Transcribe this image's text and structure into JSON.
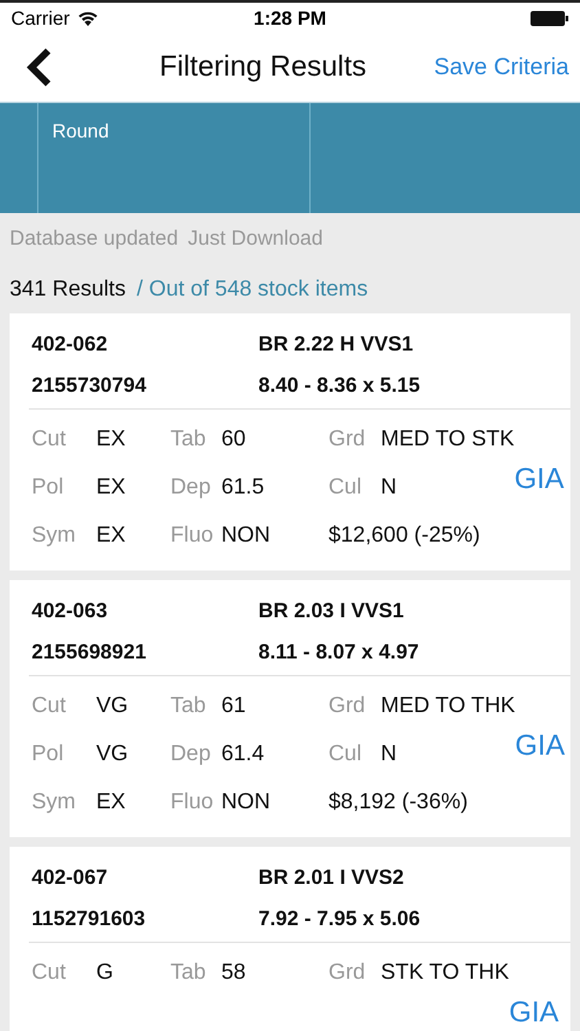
{
  "status_bar": {
    "carrier": "Carrier",
    "time": "1:28 PM"
  },
  "nav": {
    "title": "Filtering Results",
    "action": "Save Criteria"
  },
  "filter_bar": {
    "shape": "Round"
  },
  "info": {
    "status": "Database updated",
    "download": "Just Download"
  },
  "results": {
    "count": "341 Results",
    "total": "/ Out of 548 stock items"
  },
  "items": [
    {
      "stock_no": "402-062",
      "description": "BR 2.22 H VVS1",
      "id": "2155730794",
      "measurements": "8.40 - 8.36 x 5.15",
      "details": [
        {
          "label": "Cut",
          "value": "EX"
        },
        {
          "label": "Tab",
          "value": "60"
        },
        {
          "label": "Grd",
          "value": "MED TO STK"
        },
        {
          "label": "Pol",
          "value": "EX"
        },
        {
          "label": "Dep",
          "value": "61.5"
        },
        {
          "label": "Cul",
          "value": "N"
        },
        {
          "label": "Sym",
          "value": "EX"
        },
        {
          "label": "Fluo",
          "value": "NON"
        }
      ],
      "price": "$12,600 (-25%)",
      "lab": "GIA"
    },
    {
      "stock_no": "402-063",
      "description": "BR 2.03 I VVS1",
      "id": "2155698921",
      "measurements": "8.11 - 8.07 x 4.97",
      "details": [
        {
          "label": "Cut",
          "value": "VG"
        },
        {
          "label": "Tab",
          "value": "61"
        },
        {
          "label": "Grd",
          "value": "MED TO THK"
        },
        {
          "label": "Pol",
          "value": "VG"
        },
        {
          "label": "Dep",
          "value": "61.4"
        },
        {
          "label": "Cul",
          "value": "N"
        },
        {
          "label": "Sym",
          "value": "EX"
        },
        {
          "label": "Fluo",
          "value": "NON"
        }
      ],
      "price": "$8,192 (-36%)",
      "lab": "GIA"
    },
    {
      "stock_no": "402-067",
      "description": "BR 2.01 I VVS2",
      "id": "1152791603",
      "measurements": "7.92 - 7.95 x 5.06",
      "details": [
        {
          "label": "Cut",
          "value": "G"
        },
        {
          "label": "Tab",
          "value": "58"
        },
        {
          "label": "Grd",
          "value": "STK TO THK"
        }
      ],
      "lab": "GIA"
    }
  ]
}
